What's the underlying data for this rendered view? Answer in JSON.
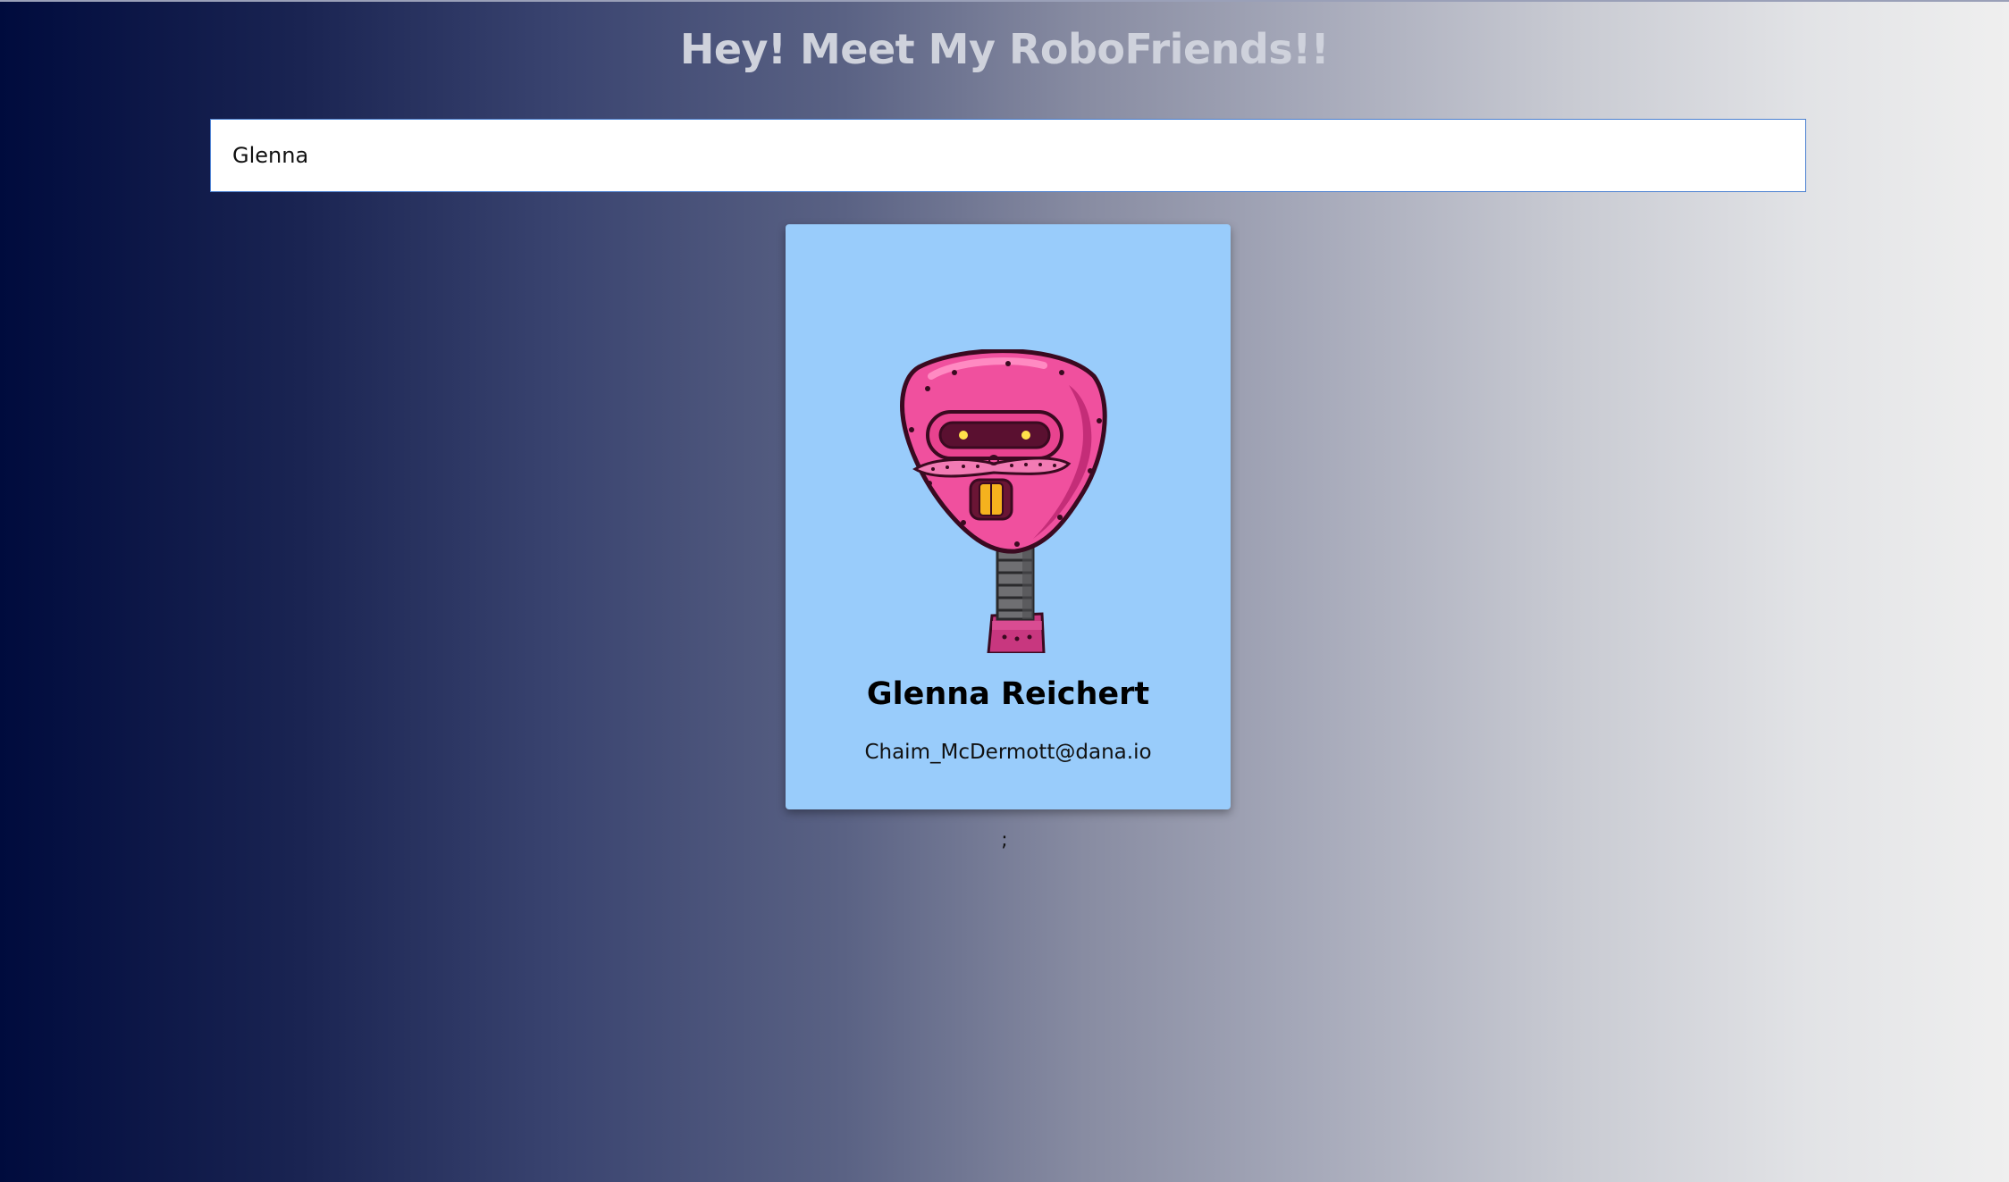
{
  "header": {
    "title": "Hey! Meet My RoboFriends!!"
  },
  "search": {
    "value": "Glenna "
  },
  "cards": [
    {
      "name": "Glenna Reichert",
      "email": "Chaim_McDermott@dana.io",
      "avatar_icon": "pink-robot-avatar"
    }
  ],
  "footer": {
    "stray_text": ";"
  },
  "colors": {
    "card_background": "#99ccfb",
    "title_color": "#cfd2dc",
    "search_border": "#4a7fd0",
    "robot_pink": "#f0509e"
  }
}
